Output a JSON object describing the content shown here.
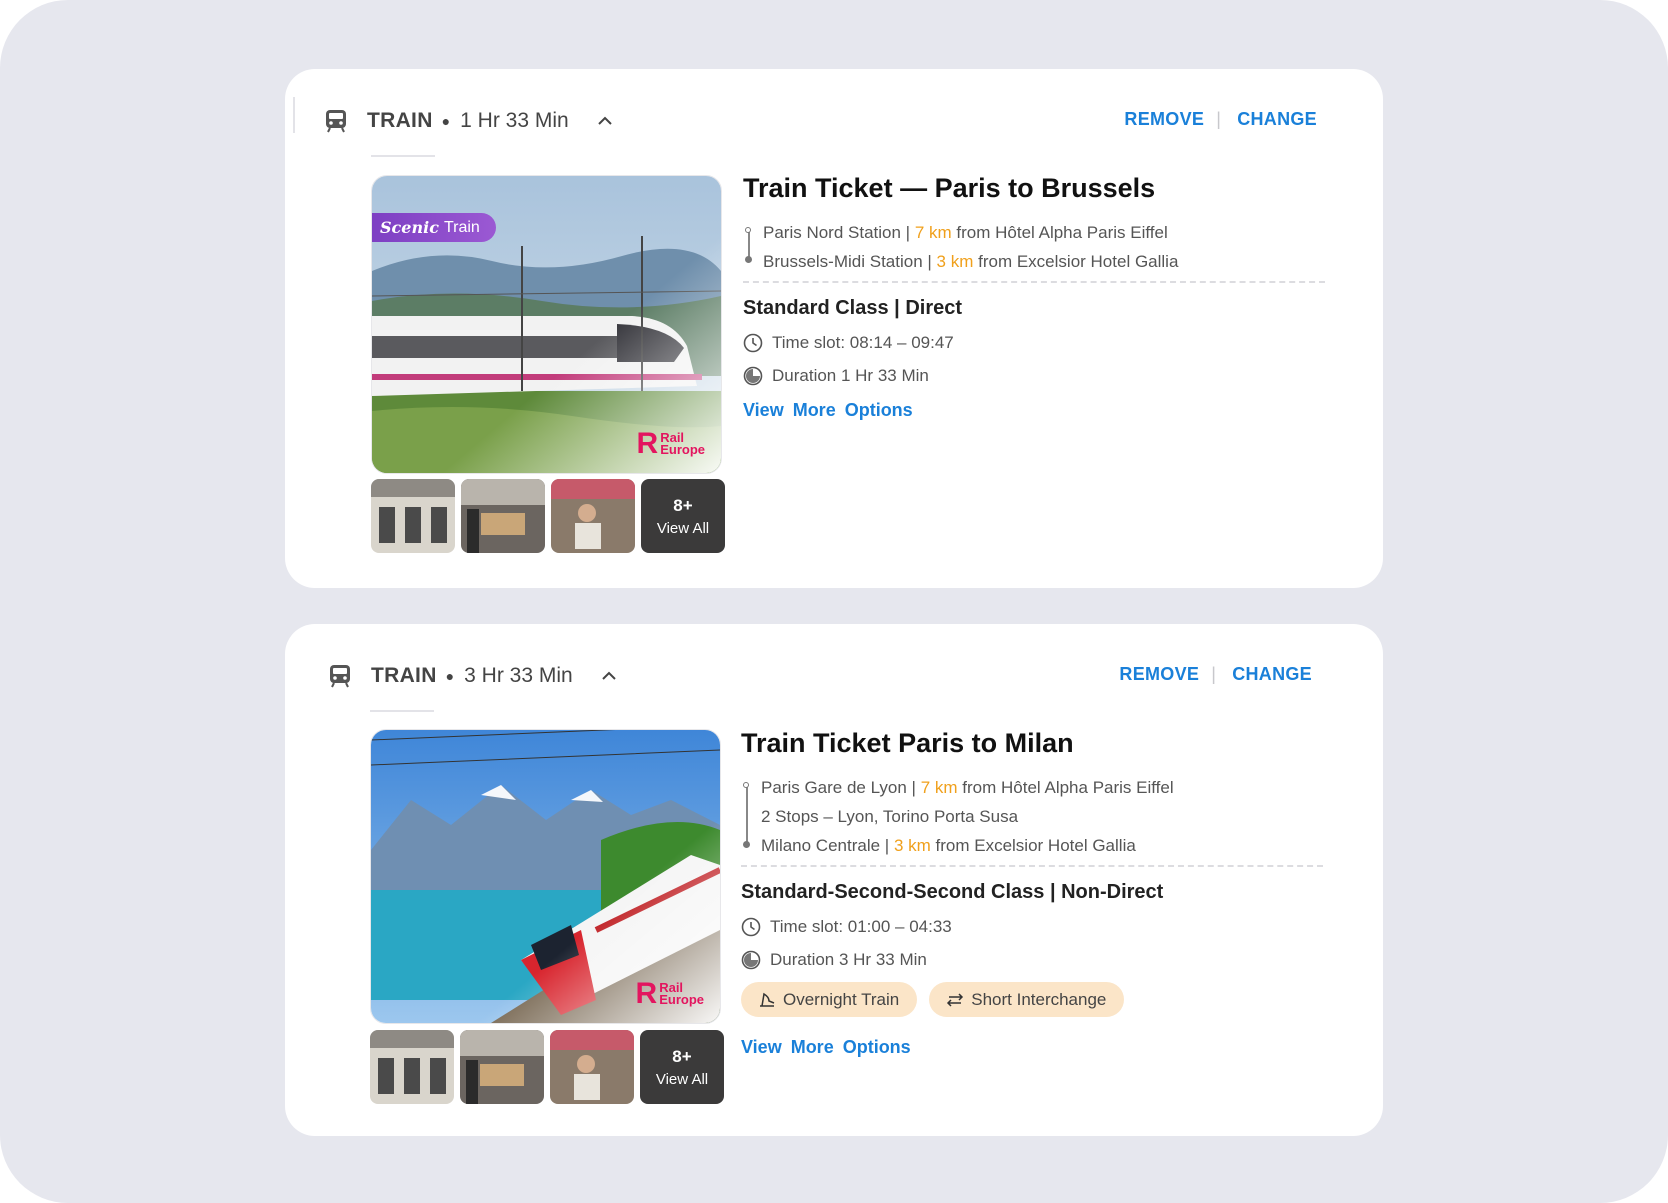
{
  "colors": {
    "accent": "#1a80d9",
    "distance": "#f0a01c",
    "badge": "#8a4ad0",
    "tag_bg": "#fbe5c8",
    "logo": "#e3155f"
  },
  "cards": [
    {
      "mode": "TRAIN",
      "duration": "1 Hr 33 Min",
      "remove_label": "REMOVE",
      "change_label": "CHANGE",
      "badge": {
        "italic": "Scenic",
        "text": "Train"
      },
      "logo_line1": "Rail",
      "logo_line2": "Europe",
      "view_all_count": "8+",
      "view_all_label": "View All",
      "title": "Train Ticket — Paris to Brussels",
      "from": {
        "station": "Paris Nord Station |",
        "km": "7 km",
        "rest": "from Hôtel Alpha Paris Eiffel"
      },
      "to": {
        "station": "Brussels-Midi Station |",
        "km": "3 km",
        "rest": "from Excelsior Hotel Gallia"
      },
      "class_text": "Standard Class | Direct",
      "time_slot": "Time slot: 08:14 – 09:47",
      "duration_text": "Duration 1 Hr 33 Min",
      "more_options": "View More Options"
    },
    {
      "mode": "TRAIN",
      "duration": "3 Hr 33 Min",
      "remove_label": "REMOVE",
      "change_label": "CHANGE",
      "logo_line1": "Rail",
      "logo_line2": "Europe",
      "view_all_count": "8+",
      "view_all_label": "View All",
      "title": "Train Ticket Paris to Milan",
      "from": {
        "station": "Paris Gare de Lyon |",
        "km": "7 km",
        "rest": "from Hôtel Alpha Paris Eiffel"
      },
      "stops": "2 Stops – Lyon, Torino Porta Susa",
      "to": {
        "station": "Milano Centrale |",
        "km": "3 km",
        "rest": "from Excelsior Hotel Gallia"
      },
      "class_text": "Standard-Second-Second Class | Non-Direct",
      "time_slot": "Time slot: 01:00 – 04:33",
      "duration_text": "Duration 3 Hr 33 Min",
      "tags": [
        "Overnight Train",
        "Short Interchange"
      ],
      "more_options": "View More Options"
    }
  ],
  "icons": [
    "train-icon",
    "chevron-up-icon",
    "clock-icon",
    "duration-icon",
    "overnight-icon",
    "interchange-icon"
  ]
}
